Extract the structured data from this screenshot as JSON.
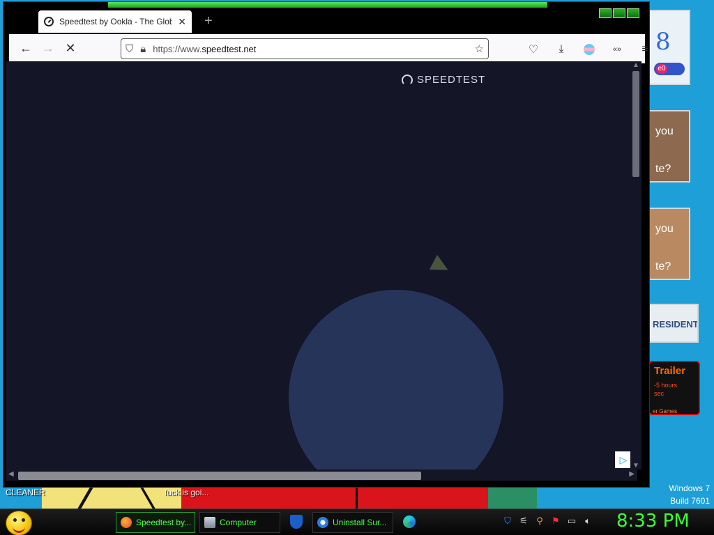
{
  "browser": {
    "tab_title": "Speedtest by Ookla - The Globe",
    "tab_close": "✕",
    "new_tab": "+",
    "url_prefix": "https://www.",
    "url_domain": "speedtest.net",
    "nav": {
      "back": "←",
      "forward": "→",
      "stop": "✕"
    }
  },
  "page": {
    "logo_text": "SPEEDTEST"
  },
  "desktop": {
    "label_left": "CLEANER",
    "label_mid": "fuck is goi...",
    "windows_version": "Windows 7",
    "build": "Build 7601",
    "gadgets": {
      "g2_line1": "you",
      "g2_line2": "te?",
      "g3_line1": "you",
      "g3_line2": "te?",
      "g4_text": "RESIDENT",
      "g5_title": "Trailer",
      "g5_line1": "-5 hours",
      "g5_line2": "sec",
      "g5_footer": "er Games"
    }
  },
  "taskbar": {
    "items": [
      {
        "label": "Speedtest by...",
        "icon": "firefox-icon"
      },
      {
        "label": "Computer",
        "icon": "computer-icon"
      },
      {
        "label": "Uninstall Sur...",
        "icon": "ie-icon"
      }
    ],
    "clock": "8:33 PM"
  },
  "colors": {
    "desktop_bg": "#1e9fd8",
    "page_bg": "#141526",
    "circle": "#26345a",
    "taskbar_text": "#4cff4c"
  }
}
